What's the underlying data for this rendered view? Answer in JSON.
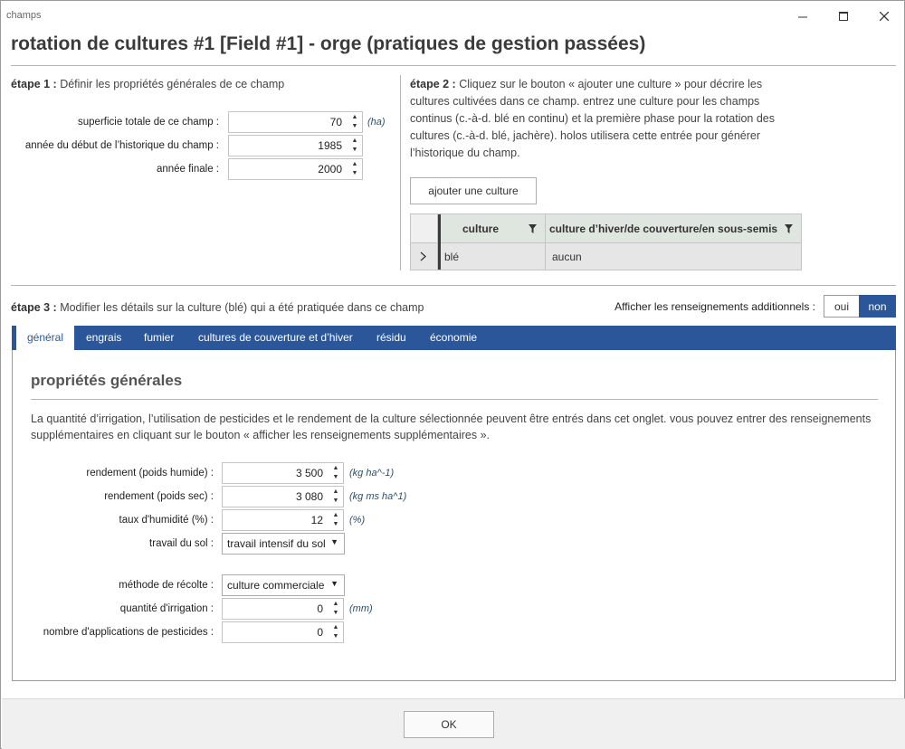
{
  "window": {
    "title": "champs"
  },
  "page_title": "rotation de cultures #1 [Field #1] - orge  (pratiques de gestion passées)",
  "icons": {
    "minimize": "minimize-icon",
    "maximize": "maximize-icon",
    "close": "close-icon",
    "spin": "spin-arrows-icon",
    "filter": "filter-icon",
    "expand": "chevron-right-icon",
    "dropdown": "dropdown-arrow-icon"
  },
  "step1": {
    "label": "étape 1 :",
    "text": " Définir les propriétés générales de ce champ",
    "fields": [
      {
        "label": "superficie totale de ce champ :",
        "value": "70",
        "unit": "(ha)"
      },
      {
        "label": "année du début de l’historique du champ :",
        "value": "1985",
        "unit": ""
      },
      {
        "label": "année finale :",
        "value": "2000",
        "unit": ""
      }
    ]
  },
  "step2": {
    "label": "étape 2 :",
    "text": " Cliquez sur le bouton « ajouter une culture » pour décrire les cultures cultivées dans ce champ. entrez une culture pour les champs continus (c.-à-d. blé en continu) et la première phase pour la rotation des cultures (c.-à-d. blé, jachère). holos utilisera cette entrée pour générer l’historique du champ.",
    "add_button": "ajouter une culture",
    "grid": {
      "columns": [
        "culture",
        "culture d’hiver/de couverture/en sous-semis"
      ],
      "rows": [
        {
          "culture": "blé",
          "cover": "aucun"
        }
      ]
    }
  },
  "step3": {
    "label": "étape 3 :",
    "text": " Modifier les détails sur la culture (blé) qui a été pratiquée dans ce champ",
    "toggle_label": "Afficher les renseignements additionnels :",
    "toggle_yes": "oui",
    "toggle_no": "non",
    "toggle_selected": "non"
  },
  "tabs": [
    "général",
    "engrais",
    "fumier",
    "cultures de couverture et d’hiver",
    "résidu",
    "économie"
  ],
  "active_tab": "général",
  "general": {
    "heading": "propriétés générales",
    "description": "La quantité d’irrigation, l’utilisation de pesticides et le rendement de la culture sélectionnée peuvent être entrés dans cet onglet. vous pouvez entrer des renseignements supplémentaires en cliquant sur le bouton « afficher les renseignements supplémentaires ».",
    "yield_wet": {
      "label": "rendement (poids humide) :",
      "value": "3 500",
      "unit": "(kg ha^-1)"
    },
    "yield_dry": {
      "label": "rendement (poids sec) :",
      "value": "3 080",
      "unit": "(kg ms ha^1)"
    },
    "moisture": {
      "label": "taux d'humidité (%) :",
      "value": "12",
      "unit": "(%)"
    },
    "tillage": {
      "label": "travail du sol :",
      "value": "travail intensif du sol"
    },
    "harvest": {
      "label": "méthode de récolte :",
      "value": "culture commerciale"
    },
    "irrigation": {
      "label": "quantité d'irrigation :",
      "value": "0",
      "unit": "(mm)"
    },
    "pesticides": {
      "label": "nombre d'applications de pesticides :",
      "value": "0"
    }
  },
  "footer": {
    "ok": "OK"
  },
  "colors": {
    "tab_bar": "#2b579a",
    "toggle_selected": "#2b579a",
    "grid_header": "#dfe6df",
    "unit_text": "#2d4f6b"
  }
}
